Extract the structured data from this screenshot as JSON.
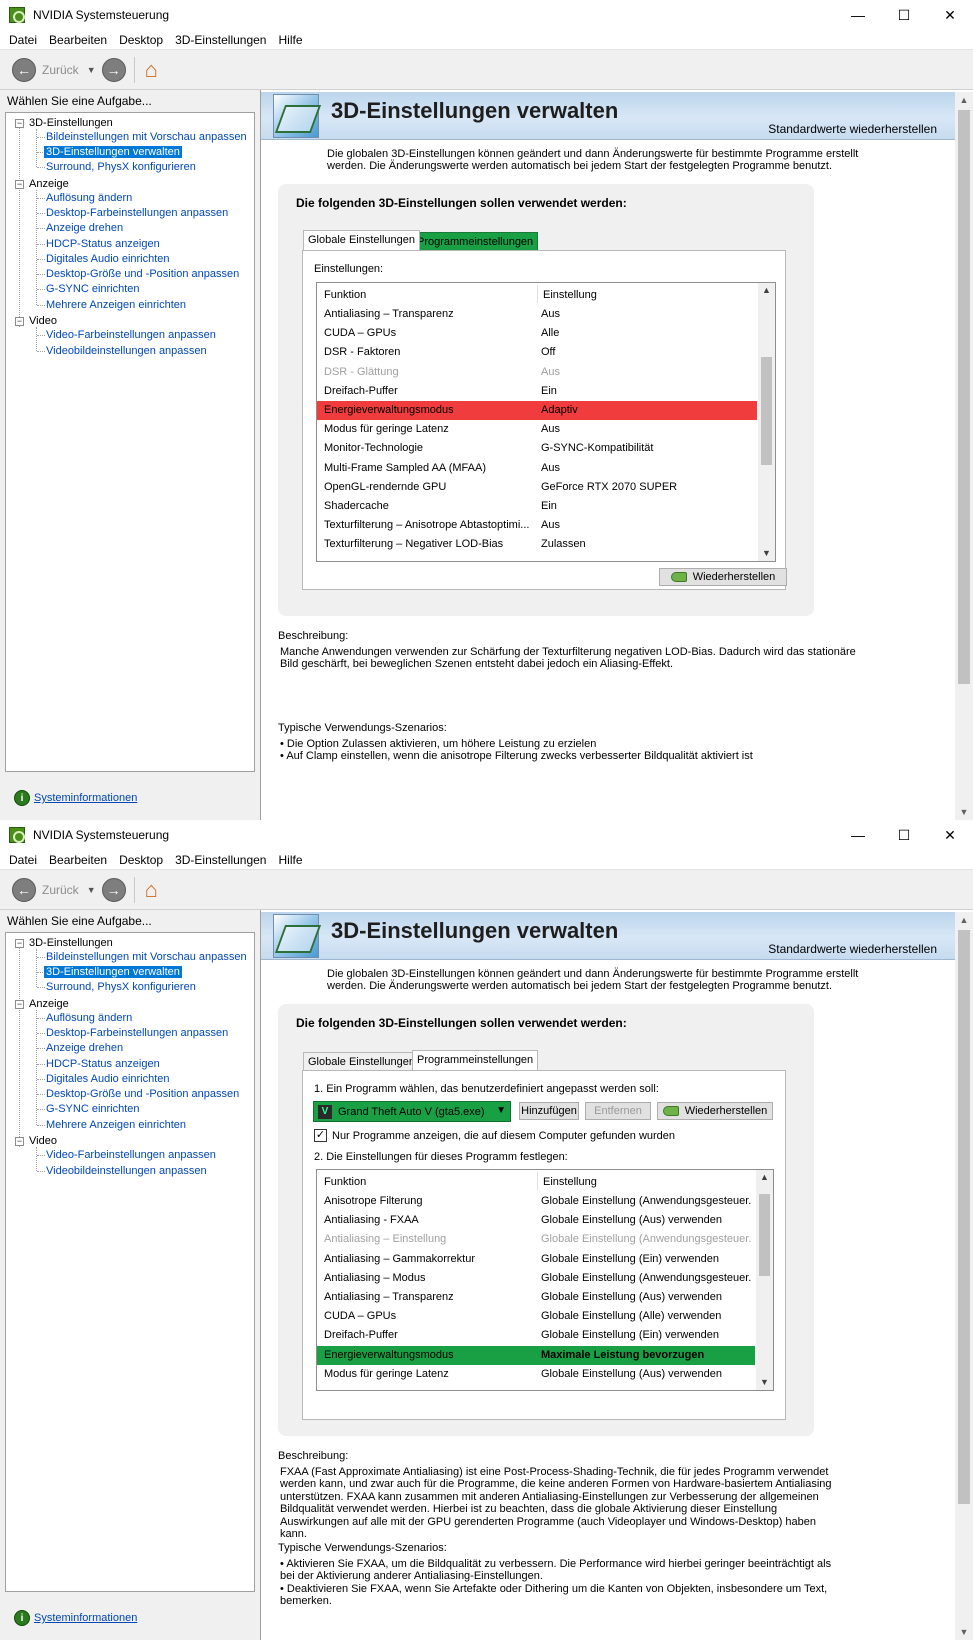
{
  "window": {
    "title": "NVIDIA Systemsteuerung",
    "controls": {
      "minimize": "—",
      "maximize": "☐",
      "close": "✕"
    }
  },
  "menu": [
    "Datei",
    "Bearbeiten",
    "Desktop",
    "3D-Einstellungen",
    "Hilfe"
  ],
  "toolbar": {
    "back_label": "Zurück",
    "back_icon": "back-arrow-icon",
    "forward_icon": "forward-arrow-icon",
    "home_icon": "home-icon"
  },
  "left": {
    "task_title": "Wählen Sie eine Aufgabe...",
    "groups": [
      {
        "label": "3D-Einstellungen",
        "items": [
          "Bildeinstellungen mit Vorschau anpassen",
          "3D-Einstellungen verwalten",
          "Surround, PhysX konfigurieren"
        ]
      },
      {
        "label": "Anzeige",
        "items": [
          "Auflösung ändern",
          "Desktop-Farbeinstellungen anpassen",
          "Anzeige drehen",
          "HDCP-Status anzeigen",
          "Digitales Audio einrichten",
          "Desktop-Größe und -Position anpassen",
          "G-SYNC einrichten",
          "Mehrere Anzeigen einrichten"
        ]
      },
      {
        "label": "Video",
        "items": [
          "Video-Farbeinstellungen anpassen",
          "Videobildeinstellungen anpassen"
        ]
      }
    ],
    "selected_item": "3D-Einstellungen verwalten",
    "sysinfo": "Systeminformationen"
  },
  "header": {
    "title": "3D-Einstellungen verwalten",
    "restore_defaults": "Standardwerte wiederherstellen",
    "intro": "Die globalen 3D-Einstellungen können geändert und dann Änderungswerte für bestimmte Programme erstellt werden. Die Änderungswerte werden automatisch bei jedem Start der festgelegten Programme benutzt."
  },
  "group_title": "Die folgenden 3D-Einstellungen sollen verwendet werden:",
  "tabs": {
    "global": "Globale Einstellungen",
    "program": "Programmeinstellungen"
  },
  "win1": {
    "settings_label": "Einstellungen:",
    "col_function": "Funktion",
    "col_setting": "Einstellung",
    "rows": [
      {
        "f": "Antialiasing – Transparenz",
        "s": "Aus"
      },
      {
        "f": "CUDA – GPUs",
        "s": "Alle"
      },
      {
        "f": "DSR - Faktoren",
        "s": "Off"
      },
      {
        "f": "DSR - Glättung",
        "s": "Aus",
        "disabled": true
      },
      {
        "f": "Dreifach-Puffer",
        "s": "Ein"
      },
      {
        "f": "Energieverwaltungsmodus",
        "s": "Adaptiv",
        "highlight": "#f03c3c"
      },
      {
        "f": "Modus für geringe Latenz",
        "s": "Aus"
      },
      {
        "f": "Monitor-Technologie",
        "s": "G-SYNC-Kompatibilität"
      },
      {
        "f": "Multi-Frame Sampled AA (MFAA)",
        "s": "Aus"
      },
      {
        "f": "OpenGL-rendernde GPU",
        "s": "GeForce RTX 2070 SUPER"
      },
      {
        "f": "Shadercache",
        "s": "Ein"
      },
      {
        "f": "Texturfilterung – Anisotrope Abtastoptimi...",
        "s": "Aus"
      },
      {
        "f": "Texturfilterung – Negativer LOD-Bias",
        "s": "Zulassen"
      }
    ],
    "restore_button": "Wiederherstellen",
    "desc_label": "Beschreibung:",
    "desc_text": "Manche Anwendungen verwenden zur Schärfung der Texturfilterung negativen LOD-Bias. Dadurch wird das stationäre Bild geschärft, bei beweglichen Szenen entsteht dabei jedoch ein Aliasing-Effekt.",
    "usage_label": "Typische Verwendungs-Szenarios:",
    "usage": [
      "Die Option Zulassen aktivieren, um höhere Leistung zu erzielen",
      "Auf Clamp einstellen, wenn die anisotrope Filterung zwecks verbesserter Bildqualität aktiviert ist"
    ]
  },
  "win2": {
    "step1": "1. Ein Programm wählen, das benutzerdefiniert angepasst werden soll:",
    "program_selected": "Grand Theft Auto V (gta5.exe)",
    "add_button": "Hinzufügen",
    "remove_button": "Entfernen",
    "restore_button": "Wiederherstellen",
    "checkbox_label": "Nur Programme anzeigen, die auf diesem Computer gefunden wurden",
    "checkbox_checked": true,
    "step2": "2. Die Einstellungen für dieses Programm festlegen:",
    "col_function": "Funktion",
    "col_setting": "Einstellung",
    "rows": [
      {
        "f": "Anisotrope Filterung",
        "s": "Globale Einstellung (Anwendungsgesteuer..."
      },
      {
        "f": "Antialiasing - FXAA",
        "s": "Globale Einstellung (Aus) verwenden"
      },
      {
        "f": "Antialiasing – Einstellung",
        "s": "Globale Einstellung (Anwendungsgesteuer...",
        "disabled": true
      },
      {
        "f": "Antialiasing – Gammakorrektur",
        "s": "Globale Einstellung (Ein) verwenden"
      },
      {
        "f": "Antialiasing – Modus",
        "s": "Globale Einstellung (Anwendungsgesteuer..."
      },
      {
        "f": "Antialiasing – Transparenz",
        "s": "Globale Einstellung (Aus) verwenden"
      },
      {
        "f": "CUDA – GPUs",
        "s": "Globale Einstellung (Alle) verwenden"
      },
      {
        "f": "Dreifach-Puffer",
        "s": "Globale Einstellung (Ein) verwenden"
      },
      {
        "f": "Energieverwaltungsmodus",
        "s": "Maximale Leistung bevorzugen",
        "highlight": "#19a045"
      },
      {
        "f": "Modus für geringe Latenz",
        "s": "Globale Einstellung (Aus) verwenden"
      }
    ],
    "desc_label": "Beschreibung:",
    "desc_text": "FXAA (Fast Approximate Antialiasing) ist eine Post-Process-Shading-Technik, die für jedes Programm verwendet werden kann, und zwar auch für die Programme, die keine anderen Formen von Hardware-basiertem Antialiasing unterstützen. FXAA kann zusammen mit anderen Antialiasing-Einstellungen zur Verbesserung der allgemeinen Bildqualität verwendet werden. Hierbei ist zu beachten, dass die globale Aktivierung dieser Einstellung Auswirkungen auf alle mit der GPU gerenderten Programme (auch Videoplayer und Windows-Desktop) haben kann.",
    "usage_label": "Typische Verwendungs-Szenarios:",
    "usage": [
      "Aktivieren Sie FXAA, um die Bildqualität zu verbessern. Die Performance wird hierbei geringer beeinträchtigt als bei der Aktivierung anderer Antialiasing-Einstellungen.",
      "Deaktivieren Sie FXAA, wenn Sie Artefakte oder Dithering um die Kanten von Objekten, insbesondere um Text, bemerken."
    ]
  }
}
